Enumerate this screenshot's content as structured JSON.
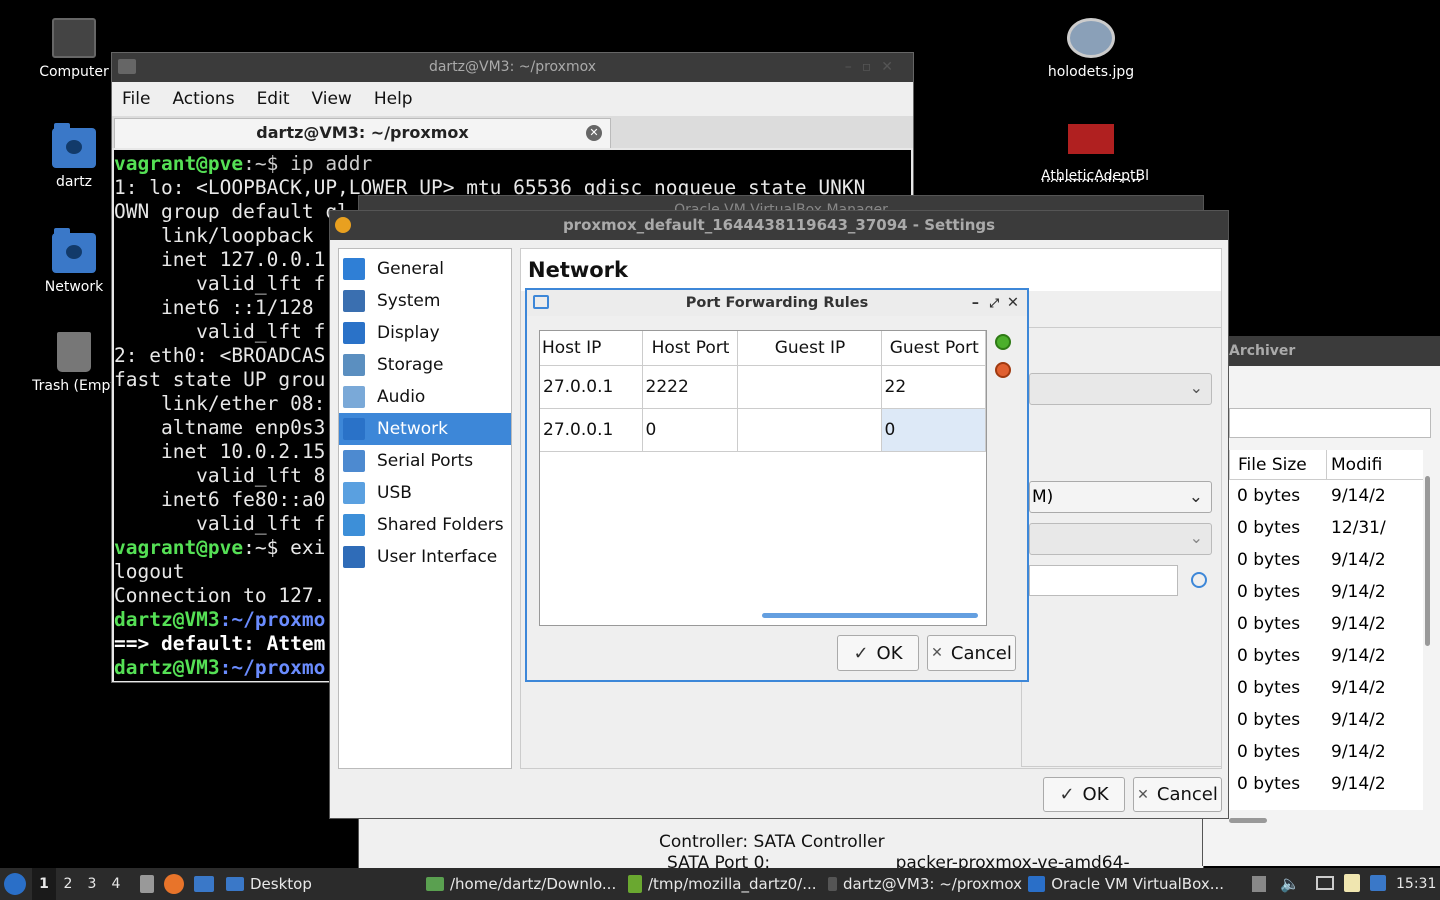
{
  "desktop": {
    "icons": [
      {
        "label": "Computer"
      },
      {
        "label": "dartz"
      },
      {
        "label": "Network"
      },
      {
        "label": "Trash (Empt"
      },
      {
        "label": "holodets.jpg"
      },
      {
        "label": "AthleticAdeptBl",
        "label2": "uetonguelizard-"
      }
    ]
  },
  "terminal": {
    "title": "dartz@VM3: ~/proxmox",
    "menu": [
      "File",
      "Actions",
      "Edit",
      "View",
      "Help"
    ],
    "tab_label": "dartz@VM3: ~/proxmox",
    "lines": {
      "l1_user": "vagrant@pve",
      "l1_rest": ":~$ ip addr",
      "l2": "1: lo: <LOOPBACK,UP,LOWER_UP> mtu 65536 qdisc noqueue state UNKN",
      "l3": "OWN group default ql",
      "l4": "    link/loopback",
      "l5": "    inet 127.0.0.1",
      "l6": "       valid_lft f",
      "l7": "    inet6 ::1/128",
      "l8": "       valid_lft f",
      "l9": "2: eth0: <BROADCAS",
      "l10": "fast state UP grou",
      "l11": "    link/ether 08:",
      "l12": "    altname enp0s3",
      "l13": "    inet 10.0.2.15",
      "l14": "       valid_lft 8",
      "l15": "    inet6 fe80::a0",
      "l16": "       valid_lft f",
      "l17_user": "vagrant@pve",
      "l17_rest": ":~$ exi",
      "l18": "logout",
      "l19": "Connection to 127.",
      "l20_user": "dartz@VM3",
      "l20_path": ":~/proxmo",
      "l21": "==> default: Attem",
      "l22_user": "dartz@VM3",
      "l22_path": ":~/proxmo"
    }
  },
  "vbox_manager": {
    "title": "Oracle VM VirtualBox Manager",
    "controller": "Controller: SATA Controller",
    "sata_port": "SATA Port 0:",
    "sata_value": "packer-proxmox-ve-amd64-"
  },
  "archiver": {
    "title": "Archiver",
    "columns": [
      "File Size",
      "Modifi"
    ],
    "rows": [
      {
        "size": "0 bytes",
        "date": "9/14/2"
      },
      {
        "size": "0 bytes",
        "date": "12/31/"
      },
      {
        "size": "0 bytes",
        "date": "9/14/2"
      },
      {
        "size": "0 bytes",
        "date": "9/14/2"
      },
      {
        "size": "0 bytes",
        "date": "9/14/2"
      },
      {
        "size": "0 bytes",
        "date": "9/14/2"
      },
      {
        "size": "0 bytes",
        "date": "9/14/2"
      },
      {
        "size": "0 bytes",
        "date": "9/14/2"
      },
      {
        "size": "0 bytes",
        "date": "9/14/2"
      },
      {
        "size": "0 bytes",
        "date": "9/14/2"
      }
    ]
  },
  "settings": {
    "title": "proxmox_default_1644438119643_37094 - Settings",
    "categories": [
      {
        "label": "General",
        "color": "#2f7fd6"
      },
      {
        "label": "System",
        "color": "#3a6fb0"
      },
      {
        "label": "Display",
        "color": "#2a72c8"
      },
      {
        "label": "Storage",
        "color": "#5b8fc0"
      },
      {
        "label": "Audio",
        "color": "#7aa9d8"
      },
      {
        "label": "Network",
        "color": "#2a72c8"
      },
      {
        "label": "Serial Ports",
        "color": "#4d8ad0"
      },
      {
        "label": "USB",
        "color": "#5aa0e0"
      },
      {
        "label": "Shared Folders",
        "color": "#3d8fd8"
      },
      {
        "label": "User Interface",
        "color": "#2f6cb8"
      }
    ],
    "selected_category": "Network",
    "panel_title": "Network",
    "partial_combo_text": "M)",
    "ok_label": "OK",
    "cancel_label": "Cancel"
  },
  "port_forwarding": {
    "title": "Port Forwarding Rules",
    "columns": [
      "Host IP",
      "Host Port",
      "Guest IP",
      "Guest Port"
    ],
    "rows": [
      {
        "host_ip": "27.0.0.1",
        "host_port": "2222",
        "guest_ip": "",
        "guest_port": "22"
      },
      {
        "host_ip": "27.0.0.1",
        "host_port": "0",
        "guest_ip": "",
        "guest_port": "0"
      }
    ],
    "ok_label": "OK",
    "cancel_label": "Cancel"
  },
  "taskbar": {
    "workspaces": [
      "1",
      "2",
      "3",
      "4"
    ],
    "active_workspace": "1",
    "items": [
      {
        "label": "Desktop"
      },
      {
        "label": "/home/dartz/Downlo..."
      },
      {
        "label": "/tmp/mozilla_dartz0/..."
      },
      {
        "label": "dartz@VM3: ~/proxmox"
      },
      {
        "label": "Oracle VM VirtualBox..."
      }
    ],
    "clock": "15:31"
  }
}
